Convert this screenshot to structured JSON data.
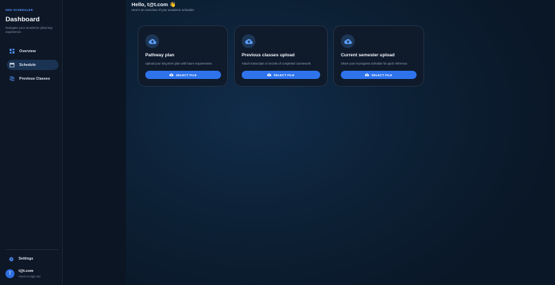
{
  "sidebar": {
    "brand": "HEN SCHEDULER",
    "title": "Dashboard",
    "subtitle": "Navigate your academic planning experience.",
    "items": [
      {
        "label": "Overview",
        "icon": "grid-icon",
        "active": false
      },
      {
        "label": "Schedule",
        "icon": "calendar-icon",
        "active": true
      },
      {
        "label": "Previous Classes",
        "icon": "history-icon",
        "active": false
      }
    ],
    "settings_label": "Settings",
    "user": {
      "initial": "T",
      "email": "t@t.com",
      "hint": "Hover to sign out"
    }
  },
  "main": {
    "greeting": "Hello, t@t.com 👋",
    "greeting_sub": "Here's an overview of your academic schedule.",
    "cards": [
      {
        "title": "Pathway plan",
        "description": "Upload your long-term plan with future requirements.",
        "button": "SELECT FILE"
      },
      {
        "title": "Previous classes upload",
        "description": "Attach transcripts or records of completed coursework.",
        "button": "SELECT FILE"
      },
      {
        "title": "Current semester upload",
        "description": "Share your in-progress schedule for quick reference.",
        "button": "SELECT FILE"
      }
    ]
  },
  "colors": {
    "accent": "#2e73ec",
    "sidebar_bg": "#0e1726",
    "card_bg": "#0f1a2b",
    "active_item_bg": "#1a3352"
  }
}
